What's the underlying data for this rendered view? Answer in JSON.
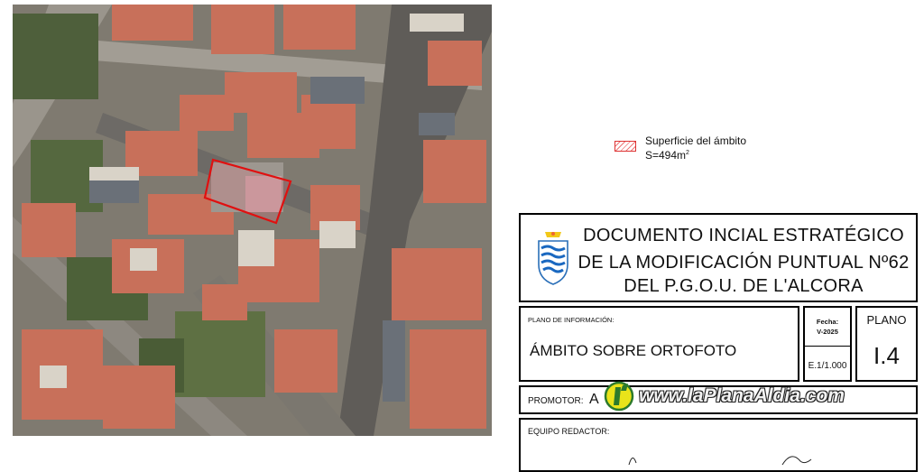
{
  "legend": {
    "label": "Superficie del ámbito",
    "area_prefix": "S=494m",
    "area_sup": "2",
    "swatch_color": "#d33333"
  },
  "title_block": {
    "title_lines": [
      "DOCUMENTO INCIAL ESTRATÉGICO",
      "DE LA MODIFICACIÓN PUNTUAL Nº62",
      "DEL P.G.O.U. DE L'ALCORA"
    ],
    "plano_info_label": "PLANO DE INFORMACIÓN:",
    "plano_name": "ÁMBITO SOBRE ORTOFOTO",
    "fecha_label": "Fecha:",
    "fecha_value": "V-2025",
    "scale": "E.1/1.000",
    "plano_label": "PLANO",
    "plano_number": "I.4",
    "promotor_label": "PROMOTOR:",
    "promotor_value": "A",
    "equipo_label": "EQUIPO REDACTOR:"
  },
  "watermark": {
    "text": "www.laPlanaAldia.com",
    "color": "#f2f2f2"
  },
  "site_outline_color": "#e01010"
}
